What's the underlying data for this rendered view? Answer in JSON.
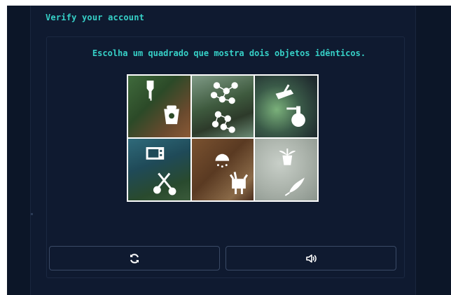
{
  "captcha": {
    "title": "Verify your account",
    "instruction": "Escolha um quadrado que mostra dois objetos idênticos.",
    "tiles": [
      {
        "icons": [
          "flashlight-icon",
          "pot-icon"
        ]
      },
      {
        "icons": [
          "network-icon",
          "network-icon"
        ]
      },
      {
        "icons": [
          "broom-icon",
          "flask-icon"
        ]
      },
      {
        "icons": [
          "microwave-icon",
          "scissors-icon"
        ]
      },
      {
        "icons": [
          "shower-head-icon",
          "moose-icon"
        ]
      },
      {
        "icons": [
          "potted-plant-icon",
          "feather-icon"
        ]
      }
    ],
    "buttons": {
      "refresh_icon": "refresh-icon",
      "audio_icon": "speaker-icon"
    }
  },
  "colors": {
    "background": "#0f1a30",
    "accent": "#36d0c7",
    "button_border": "#3a4a66",
    "icon": "#ffffff"
  }
}
